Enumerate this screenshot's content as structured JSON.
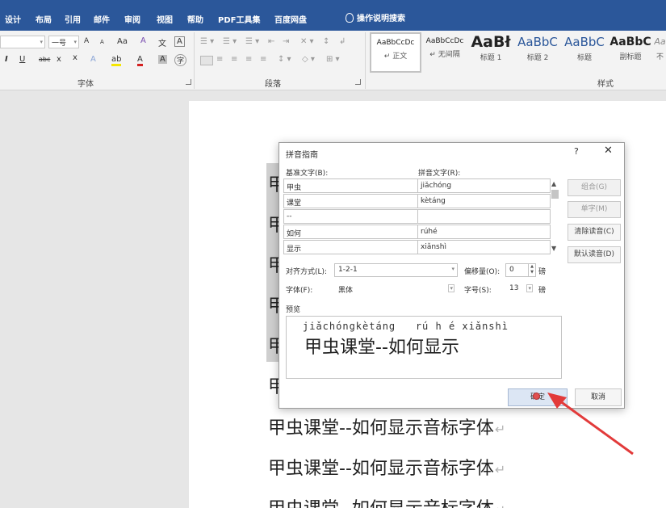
{
  "ribbon_tabs": [
    "设计",
    "布局",
    "引用",
    "邮件",
    "审阅",
    "视图",
    "帮助",
    "PDF工具集",
    "百度网盘"
  ],
  "tell_me": "操作说明搜索",
  "ribbon": {
    "font_size_value": "一号",
    "font_group_label": "字体",
    "paragraph_group_label": "段落",
    "styles_group_label": "样式",
    "font_grow": "A",
    "font_shrink": "A",
    "change_case": "Aa",
    "bold": "B",
    "italic": "I",
    "underline": "U",
    "strike": "abc",
    "subscript": "x",
    "superscript": "x",
    "text_effects": "A",
    "highlight": "ab",
    "font_color": "A",
    "char_shading": "A",
    "enclose": "字",
    "pinyin": "文",
    "clear_format": "A",
    "styles": [
      {
        "sample": "AaBbCcDc",
        "name": "正文"
      },
      {
        "sample": "AaBbCcDc",
        "name": "无间隔"
      },
      {
        "sample": "AaBł",
        "name": "标题 1"
      },
      {
        "sample": "AaBbC",
        "name": "标题 2"
      },
      {
        "sample": "AaBbC",
        "name": "标题"
      },
      {
        "sample": "AaBbC",
        "name": "副标题"
      },
      {
        "sample": "Aa",
        "name": "不"
      }
    ]
  },
  "document": {
    "line_text": "甲虫课堂--如何显示音标字体",
    "cropped_char": "甲",
    "partial_line": "甲虫课堂--如何显示音标字体"
  },
  "dialog": {
    "title": "拼音指南",
    "help": "?",
    "close": "✕",
    "base_text_label": "基准文字(B):",
    "ruby_text_label": "拼音文字(R):",
    "rows": [
      {
        "base": "甲虫",
        "ruby": "jiǎchóng"
      },
      {
        "base": "课堂",
        "ruby": "kètáng"
      },
      {
        "base": "--",
        "ruby": ""
      },
      {
        "base": "如何",
        "ruby": "rúhé"
      },
      {
        "base": "显示",
        "ruby": "xiǎnshì"
      }
    ],
    "buttons": {
      "group": "组合(G)",
      "mono": "单字(M)",
      "clear": "清除读音(C)",
      "default": "默认读音(D)"
    },
    "alignment_label": "对齐方式(L):",
    "alignment_value": "1-2-1",
    "offset_label": "偏移量(O):",
    "offset_value": "0",
    "offset_unit": "磅",
    "font_label": "字体(F):",
    "font_value": "黑体",
    "size_label": "字号(S):",
    "size_value": "13",
    "size_unit": "磅",
    "preview_label": "预览",
    "preview_pinyin": "jiǎchóngkètáng   rú h é xiǎnshì",
    "preview_text": "甲虫课堂--如何显示",
    "ok": "确定",
    "cancel": "取消"
  },
  "colors": {
    "ribbon_blue": "#2b579a",
    "annotation_arrow": "#e23a3a"
  }
}
